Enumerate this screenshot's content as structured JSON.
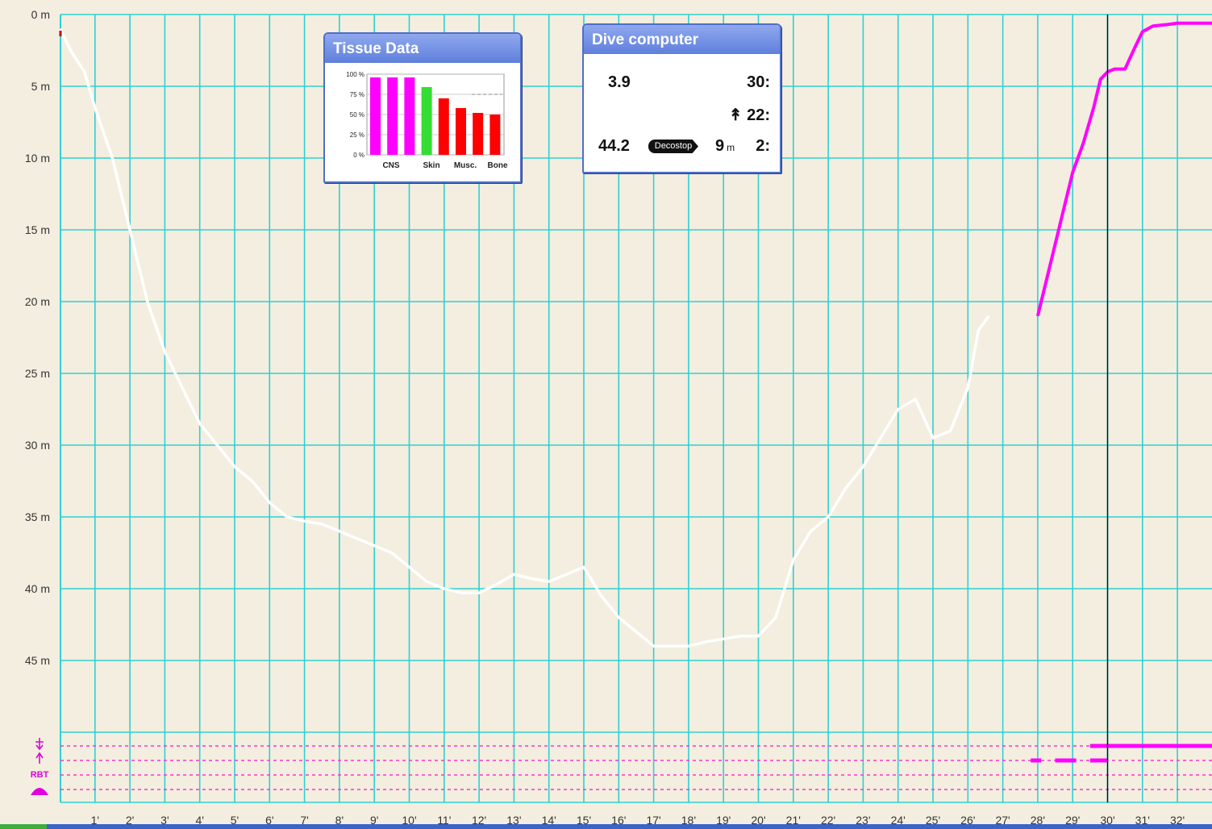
{
  "chart_data": {
    "type": "line",
    "y_axis": {
      "unit": "m",
      "range": [
        0,
        50
      ],
      "ticks": [
        0,
        5,
        10,
        15,
        20,
        25,
        30,
        35,
        40,
        45
      ],
      "tick_labels": [
        "0 m",
        "5 m",
        "10 m",
        "15 m",
        "20 m",
        "25 m",
        "30 m",
        "35 m",
        "40 m",
        "45 m"
      ]
    },
    "x_axis": {
      "unit": "min",
      "range": [
        0,
        33
      ],
      "tick_labels": [
        "1'",
        "2'",
        "3'",
        "4'",
        "5'",
        "6'",
        "7'",
        "8'",
        "9'",
        "10'",
        "11'",
        "12'",
        "13'",
        "14'",
        "15'",
        "16'",
        "17'",
        "18'",
        "19'",
        "20'",
        "21'",
        "22'",
        "23'",
        "24'",
        "25'",
        "26'",
        "27'",
        "28'",
        "29'",
        "30'",
        "31'",
        "32'"
      ]
    },
    "grid": true,
    "series": [
      {
        "color": "#ffffff",
        "x": [
          0,
          0.3,
          0.7,
          1.0,
          1.5,
          2.0,
          2.5,
          3.0,
          3.5,
          4.0,
          4.5,
          5.0,
          5.5,
          6.0,
          6.5,
          7.0,
          7.5,
          8.0,
          8.5,
          9.0,
          9.5,
          10.0,
          10.5,
          11.0,
          11.5,
          12.0,
          12.5,
          13.0,
          13.5,
          14.0,
          14.5,
          15.0,
          15.5,
          16.0,
          16.5,
          17.0,
          17.5,
          18.0,
          18.5,
          19.0,
          19.5,
          20.0,
          20.5,
          21.0,
          21.5,
          22.0,
          22.5,
          23.0,
          23.5,
          24.0,
          24.5,
          25.0,
          25.5,
          26.0,
          26.3,
          26.6,
          27.0,
          27.3,
          27.7,
          28.0
        ],
        "depth": [
          1,
          2.5,
          4,
          6.5,
          10,
          15,
          20,
          23.5,
          26,
          28.5,
          30,
          31.5,
          32.5,
          34,
          35,
          35.3,
          35.5,
          36,
          36.5,
          37,
          37.5,
          38.5,
          39.5,
          40,
          40.3,
          40.3,
          39.7,
          39,
          39.3,
          39.5,
          39,
          38.5,
          40.5,
          42,
          43,
          44,
          44,
          44,
          43.7,
          43.5,
          43.3,
          43.3,
          42,
          38,
          36,
          35,
          33,
          31.5,
          29.5,
          27.5,
          26.8,
          29.5,
          29,
          26,
          22,
          21
        ]
      },
      {
        "color": "#ff00ff",
        "x": [
          28.0,
          28.3,
          28.7,
          29.0,
          29.3,
          29.6,
          29.8,
          30.0,
          30.2,
          30.5,
          30.8,
          31.0,
          31.3,
          31.7,
          32.0,
          32.5,
          33.0
        ],
        "depth": [
          21,
          18,
          14,
          11,
          9,
          6.5,
          4.5,
          4,
          3.8,
          3.8,
          2.2,
          1.2,
          0.8,
          0.7,
          0.6,
          0.6,
          0.6
        ]
      }
    ],
    "cursor_x": 30,
    "indicators": {
      "labels": [
        "RBT"
      ],
      "segments": [
        {
          "row": 1,
          "x_from": 29.5,
          "x_to": 33
        },
        {
          "row": 2,
          "x_from": 27.8,
          "x_to": 28.1
        },
        {
          "row": 2,
          "x_from": 28.5,
          "x_to": 29.1
        },
        {
          "row": 2,
          "x_from": 29.5,
          "x_to": 30
        }
      ]
    }
  },
  "tissue": {
    "title": "Tissue Data",
    "y_labels": [
      "100 %",
      "75 %",
      "50 %",
      "25 %",
      "0 %"
    ],
    "x_labels": [
      "CNS",
      "Skin",
      "Musc.",
      "Bone"
    ],
    "bars": [
      {
        "value": 96,
        "color": "#ff00ff"
      },
      {
        "value": 96,
        "color": "#ff00ff"
      },
      {
        "value": 96,
        "color": "#ff00ff"
      },
      {
        "value": 84,
        "color": "#33dd33"
      },
      {
        "value": 70,
        "color": "#ff0000"
      },
      {
        "value": 58,
        "color": "#ff0000"
      },
      {
        "value": 52,
        "color": "#ff0000"
      },
      {
        "value": 50,
        "color": "#ff0000"
      }
    ],
    "limit_line": 75
  },
  "dive_computer": {
    "title": "Dive computer",
    "depth": "3.9",
    "time": "30:",
    "ascent": "↟ 22:",
    "max_depth": "44.2",
    "deco_label": "Decostop",
    "deco_depth": "9",
    "deco_unit": "m",
    "deco_time": "2:"
  }
}
